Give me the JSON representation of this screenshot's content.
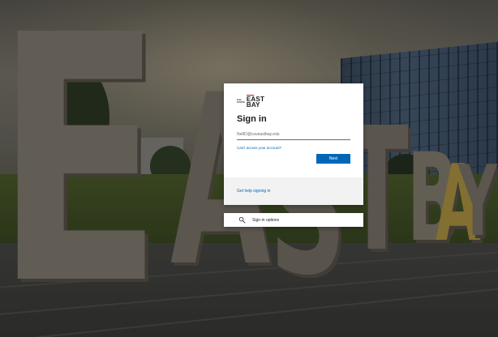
{
  "logo": {
    "small_lines": [
      "CAL",
      "STATE"
    ],
    "big_lines": [
      "EAST",
      "BAY"
    ]
  },
  "signin": {
    "title": "Sign in",
    "email_placeholder": "NetID@csueastbay.edu",
    "cant_access": "Can't access your account?",
    "next_label": "Next",
    "help_link": "Get help signing in"
  },
  "options": {
    "icon": "key-search-icon",
    "label": "Sign-in options"
  },
  "background": {
    "letters": [
      "E",
      "A",
      "S",
      "T",
      "B",
      "A",
      "Y"
    ]
  },
  "colors": {
    "accent": "#0067b8",
    "logo_bar": "#c8102e"
  }
}
